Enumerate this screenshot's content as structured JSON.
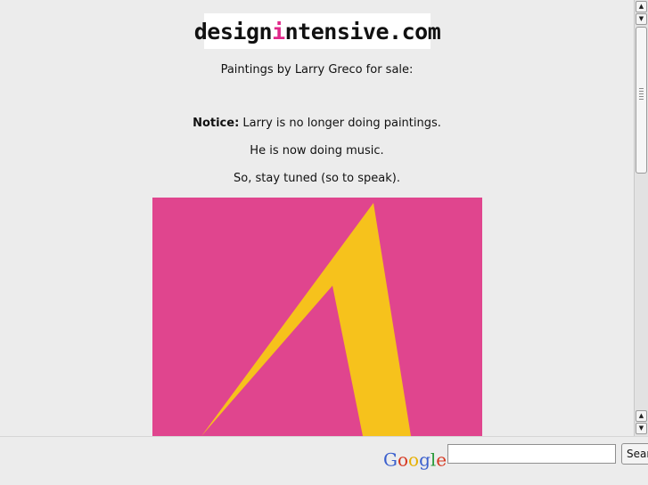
{
  "logo": {
    "part1": "design",
    "accent": "i",
    "part2": "ntensive.com",
    "accent_color": "#e0288a"
  },
  "content": {
    "subtitle": "Paintings by Larry Greco for sale:",
    "notice_label": "Notice:",
    "notice_text": " Larry is no longer doing paintings.",
    "music_line": "He is now doing music.",
    "tuned_line": "So, stay tuned (so to speak)."
  },
  "painting": {
    "background_color": "#e0458e",
    "stroke_color": "#f6c21c"
  },
  "searchbar": {
    "google_letters": [
      {
        "ch": "G",
        "color": "#3a5fcd"
      },
      {
        "ch": "o",
        "color": "#d6361f"
      },
      {
        "ch": "o",
        "color": "#e6b000"
      },
      {
        "ch": "g",
        "color": "#3a5fcd"
      },
      {
        "ch": "l",
        "color": "#2a9a3a"
      },
      {
        "ch": "e",
        "color": "#d6361f"
      }
    ],
    "google_tm": "™",
    "input_value": "",
    "button_label": "Search"
  },
  "scrollbar": {
    "up_icon": "▲",
    "down_icon": "▼"
  }
}
